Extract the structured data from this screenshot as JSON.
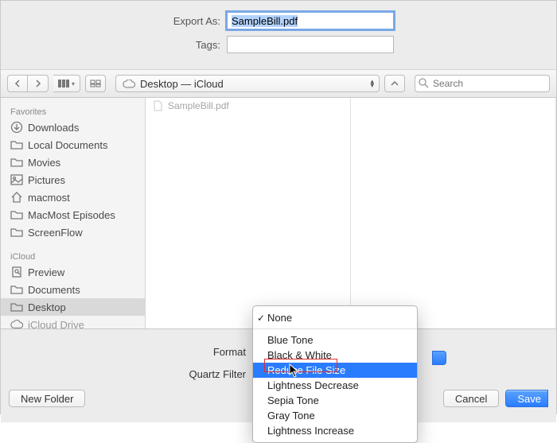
{
  "top": {
    "export_label": "Export As:",
    "filename": "SampleBill.pdf",
    "tags_label": "Tags:",
    "tags_value": ""
  },
  "toolbar": {
    "location_icon": "cloud",
    "location_text": "Desktop — iCloud",
    "search_placeholder": "Search"
  },
  "sidebar": {
    "favorites_header": "Favorites",
    "favorites": [
      {
        "icon": "downloads",
        "label": "Downloads"
      },
      {
        "icon": "folder",
        "label": "Local Documents"
      },
      {
        "icon": "folder",
        "label": "Movies"
      },
      {
        "icon": "pictures",
        "label": "Pictures"
      },
      {
        "icon": "home",
        "label": "macmost"
      },
      {
        "icon": "folder",
        "label": "MacMost Episodes"
      },
      {
        "icon": "folder",
        "label": "ScreenFlow"
      }
    ],
    "icloud_header": "iCloud",
    "icloud": [
      {
        "icon": "preview",
        "label": "Preview"
      },
      {
        "icon": "folder",
        "label": "Documents"
      },
      {
        "icon": "folder",
        "label": "Desktop",
        "selected": true
      },
      {
        "icon": "icloud",
        "label": "iCloud Drive",
        "dim": true
      }
    ]
  },
  "browser": {
    "files": [
      {
        "icon": "doc",
        "label": "SampleBill.pdf"
      }
    ]
  },
  "options": {
    "format_label": "Format",
    "quartz_label": "Quartz Filter"
  },
  "popup": {
    "items": [
      {
        "label": "None",
        "checked": true
      },
      {
        "separator": true
      },
      {
        "label": "Blue Tone"
      },
      {
        "label": "Black & White"
      },
      {
        "label": "Reduce File Size",
        "highlighted": true
      },
      {
        "label": "Lightness Decrease"
      },
      {
        "label": "Sepia Tone"
      },
      {
        "label": "Gray Tone"
      },
      {
        "label": "Lightness Increase"
      }
    ]
  },
  "footer": {
    "new_folder": "New Folder",
    "cancel": "Cancel",
    "save": "Save"
  }
}
